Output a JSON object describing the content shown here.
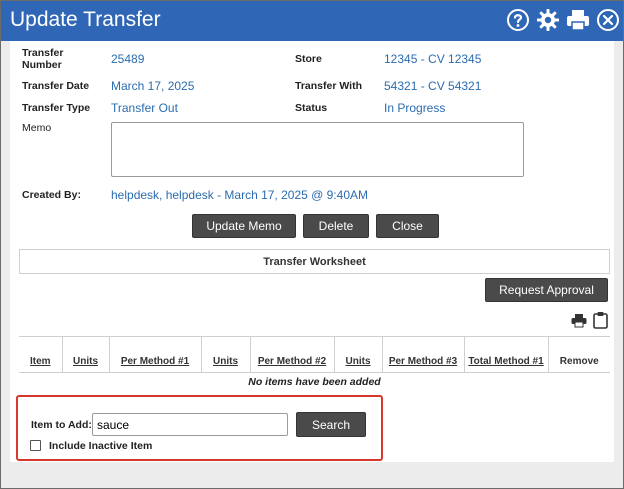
{
  "window": {
    "title": "Update Transfer"
  },
  "header_icons": [
    "help-icon",
    "gear-icon",
    "print-icon",
    "close-icon"
  ],
  "fields": {
    "transfer_number_label": "Transfer Number",
    "transfer_number": "25489",
    "store_label": "Store",
    "store": "12345 - CV 12345",
    "transfer_date_label": "Transfer Date",
    "transfer_date": "March 17, 2025",
    "transfer_with_label": "Transfer With",
    "transfer_with": "54321 - CV 54321",
    "transfer_type_label": "Transfer Type",
    "transfer_type": "Transfer Out",
    "status_label": "Status",
    "status": "In Progress",
    "memo_label": "Memo",
    "memo_value": "",
    "created_by_label": "Created By:",
    "created_by": "helpdesk, helpdesk - March 17, 2025 @ 9:40AM"
  },
  "buttons": {
    "update_memo": "Update Memo",
    "delete": "Delete",
    "close": "Close",
    "request_approval": "Request Approval",
    "search": "Search"
  },
  "worksheet": {
    "title": "Transfer Worksheet",
    "columns": [
      "Item",
      "Units",
      "Per Method #1",
      "Units",
      "Per Method #2",
      "Units",
      "Per Method #3",
      "Total Method #1",
      "Remove"
    ],
    "empty_message": "No items have been added"
  },
  "add_item": {
    "label": "Item to Add:",
    "value": "sauce",
    "include_inactive_label": "Include Inactive Item"
  },
  "colors": {
    "title_bar": "#2f67b6",
    "link": "#2b6cb0",
    "highlight_border": "#d9372b",
    "button": "#4a4a4a"
  }
}
